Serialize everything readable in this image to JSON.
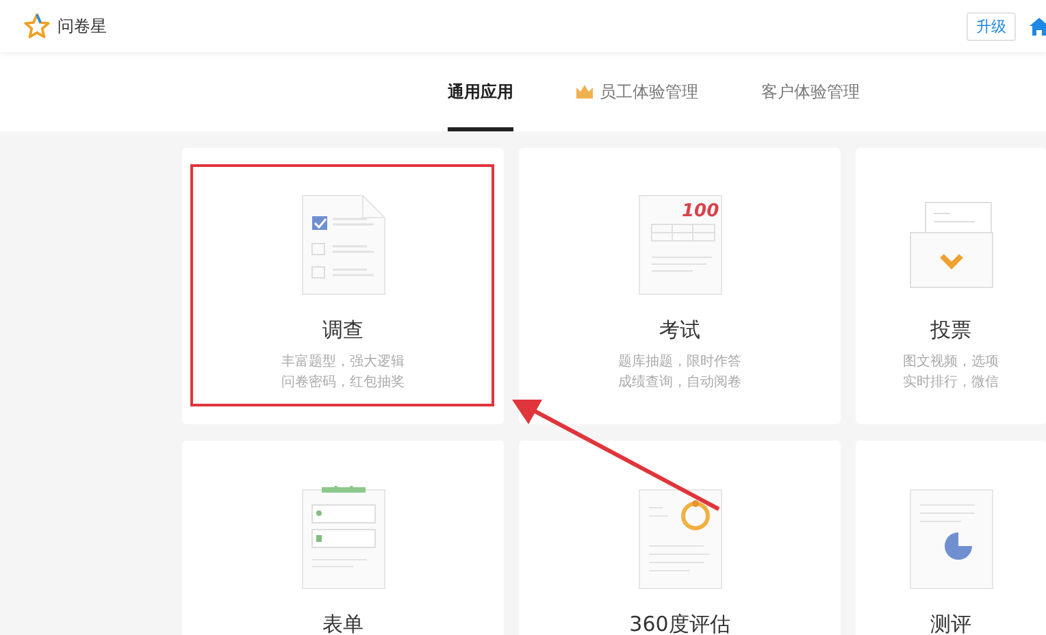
{
  "header": {
    "brand": "问卷星",
    "upgrade_button": "升级"
  },
  "tabs": [
    {
      "label": "通用应用",
      "selected": true,
      "kind": "plain"
    },
    {
      "label": "员工体验管理",
      "selected": false,
      "kind": "crown"
    },
    {
      "label": "客户体验管理",
      "selected": false,
      "kind": "plain"
    }
  ],
  "cards": [
    {
      "kind": "survey",
      "title": "调查",
      "lines": [
        "丰富题型，强大逻辑",
        "问卷密码，红包抽奖"
      ],
      "highlighted": true
    },
    {
      "kind": "exam",
      "title": "考试",
      "score_mark": "100",
      "lines": [
        "题库抽题，限时作答",
        "成绩查询，自动阅卷"
      ],
      "highlighted": false
    },
    {
      "kind": "vote",
      "title": "投票",
      "lines": [
        "图文视频，选项",
        "实时排行，微信"
      ],
      "highlighted": false
    },
    {
      "kind": "form",
      "title": "表单",
      "highlighted": false
    },
    {
      "kind": "review",
      "title": "360度评估",
      "highlighted": false
    },
    {
      "kind": "assess",
      "title": "测评",
      "highlighted": false
    }
  ]
}
